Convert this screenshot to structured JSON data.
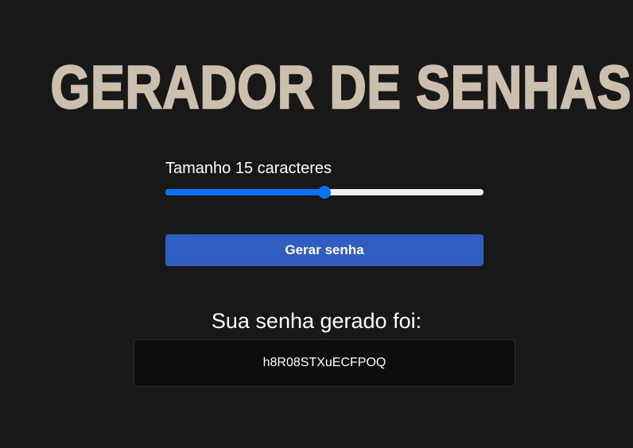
{
  "header": {
    "title": "GERADOR DE SENHAS"
  },
  "length_control": {
    "label": "Tamanho 15 caracteres",
    "value": 15,
    "slider_fraction": 0.5
  },
  "actions": {
    "generate_label": "Gerar senha"
  },
  "result": {
    "label": "Sua senha gerado foi:",
    "password": "h8R08STXuECFPOQ"
  },
  "colors": {
    "background": "#181818",
    "title": "#cdbfad",
    "slider_accent": "#0b74f6",
    "button": "#2f5ec0",
    "password_box": "#0d0d0d"
  }
}
